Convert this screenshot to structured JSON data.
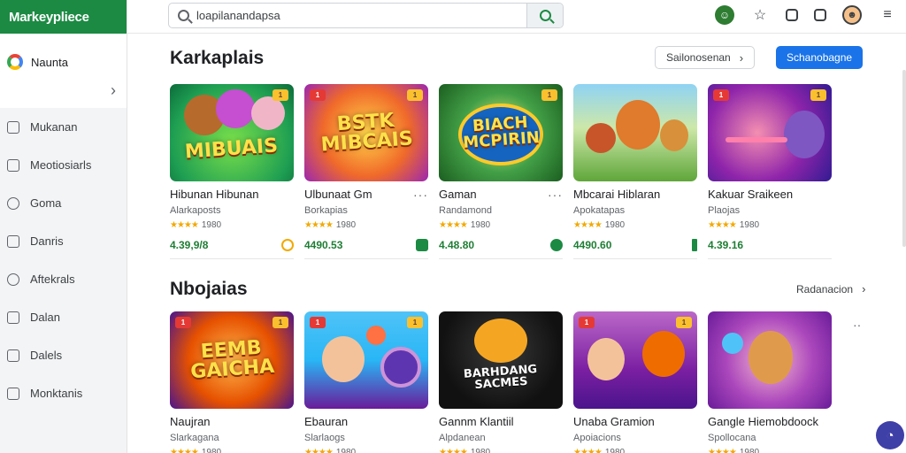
{
  "brand": {
    "name": "Markeypliece"
  },
  "sidebar": {
    "account_label": "Naunta",
    "items": [
      {
        "label": "Mukanan",
        "icon": "book-icon"
      },
      {
        "label": "Meotiosiarls",
        "icon": "grid-icon"
      },
      {
        "label": "Goma",
        "icon": "person-icon"
      },
      {
        "label": "Danris",
        "icon": "box-icon"
      },
      {
        "label": "Aftekrals",
        "icon": "shield-icon"
      },
      {
        "label": "Dalan",
        "icon": "filter-icon"
      },
      {
        "label": "Dalels",
        "icon": "tag-icon"
      },
      {
        "label": "Monktanis",
        "icon": "window-icon"
      }
    ]
  },
  "search": {
    "value": "loapilanandapsa"
  },
  "sections": [
    {
      "title": "Karkaplais",
      "secondary_button": "Sailonosenan",
      "primary_button": "Schanobagne",
      "cards": [
        {
          "art": "MIBUAIS",
          "title": "Hibunan Hibunan",
          "sub": "Alarkaposts",
          "rating": "1980",
          "price": "4.39,9/8",
          "badge_l": "1",
          "badge_r": "1"
        },
        {
          "art": "BSTK MIBCAIS",
          "title": "Ulbunaat Gm",
          "sub": "Borkapias",
          "rating": "1980",
          "price": "4490.53",
          "badge_l": "1",
          "badge_r": "1"
        },
        {
          "art": "BIACH MCPIRIN",
          "title": "Gaman",
          "sub": "Randamond",
          "rating": "1980",
          "price": "4.48.80",
          "badge_l": "",
          "badge_r": "1"
        },
        {
          "art": "",
          "title": "Mbcarai Hiblaran",
          "sub": "Apokatapas",
          "rating": "1980",
          "price": "4490.60",
          "badge_l": "",
          "badge_r": ""
        },
        {
          "art": "",
          "title": "Kakuar Sraikeen",
          "sub": "Plaojas",
          "rating": "1980",
          "price": "4.39.16",
          "badge_l": "1",
          "badge_r": "1"
        }
      ]
    },
    {
      "title": "Nbojaias",
      "see_all": "Radanacion",
      "cards": [
        {
          "art": "EEMB GAICHA",
          "title": "Naujran",
          "sub": "Slarkagana",
          "rating": "1980",
          "badge_l": "1",
          "badge_r": "1"
        },
        {
          "art": "",
          "title": "Ebauran",
          "sub": "Slarlaogs",
          "rating": "1980",
          "badge_l": "1",
          "badge_r": "1"
        },
        {
          "art": "BARHDANG SACMES",
          "title": "Gannm Klantiil",
          "sub": "Alpdanean",
          "rating": "1980",
          "badge_l": "",
          "badge_r": ""
        },
        {
          "art": "",
          "title": "Unaba Gramion",
          "sub": "Apoiacions",
          "rating": "1980",
          "badge_l": "1",
          "badge_r": "1"
        },
        {
          "art": "",
          "title": "Gangle Hiemobdoock",
          "sub": "Spollocana",
          "rating": "1980",
          "badge_l": "",
          "badge_r": ""
        }
      ]
    }
  ],
  "colors": {
    "brand_green": "#1c8a43",
    "primary_blue": "#1a73e8",
    "price_green": "#1e7e34",
    "fab": "#3f3fa8"
  }
}
